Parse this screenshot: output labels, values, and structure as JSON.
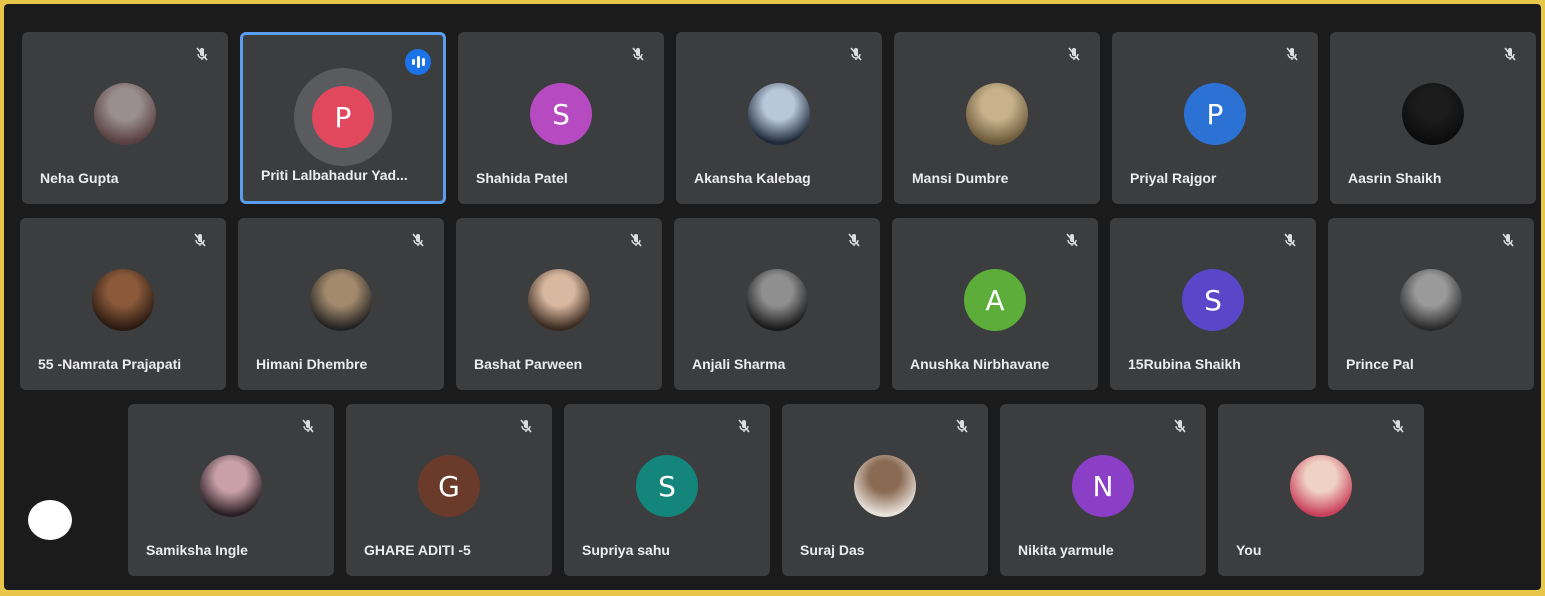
{
  "colors": {
    "tile_bg": "#3c3d3f",
    "active_speaker_border": "#5b9ded"
  },
  "participants": [
    {
      "name": "Neha Gupta",
      "type": "photo",
      "tint": [
        "#5a4040",
        "#9a8f8f"
      ],
      "muted": true
    },
    {
      "name": "Priti Lalbahadur Yad...",
      "type": "letter",
      "initial": "P",
      "color": "#e1485e",
      "speaking": true
    },
    {
      "name": "Shahida Patel",
      "type": "letter",
      "initial": "S",
      "color": "#b64bc1",
      "muted": true
    },
    {
      "name": "Akansha Kalebag",
      "type": "photo",
      "tint": [
        "#1e2a3a",
        "#b8c7d9"
      ],
      "muted": true
    },
    {
      "name": "Mansi Dumbre",
      "type": "photo",
      "tint": [
        "#6d5a3a",
        "#c7b28c"
      ],
      "muted": true
    },
    {
      "name": "Priyal Rajgor",
      "type": "letter",
      "initial": "P",
      "color": "#2b72d4",
      "muted": true
    },
    {
      "name": "Aasrin Shaikh",
      "type": "photo",
      "tint": [
        "#0c0c0c",
        "#1c1c1c"
      ],
      "muted": true
    },
    {
      "name": "55 -Namrata Prajapati",
      "type": "photo",
      "tint": [
        "#2a1a12",
        "#8a5a3a"
      ],
      "muted": true
    },
    {
      "name": "Himani Dhembre",
      "type": "photo",
      "tint": [
        "#222",
        "#a38a6d"
      ],
      "muted": true
    },
    {
      "name": "Bashat Parween",
      "type": "photo",
      "tint": [
        "#3a2a20",
        "#d9b8a0"
      ],
      "muted": true
    },
    {
      "name": "Anjali Sharma",
      "type": "photo",
      "tint": [
        "#1a1a1a",
        "#8f8f8f"
      ],
      "muted": true
    },
    {
      "name": "Anushka Nirbhavane",
      "type": "letter",
      "initial": "A",
      "color": "#5dad3a",
      "muted": true
    },
    {
      "name": "15Rubina Shaikh",
      "type": "letter",
      "initial": "S",
      "color": "#5b45c9",
      "muted": true
    },
    {
      "name": "Prince Pal",
      "type": "photo",
      "tint": [
        "#2a2a2a",
        "#9a9a9a"
      ],
      "muted": true
    },
    {
      "name": "Samiksha Ingle",
      "type": "photo",
      "tint": [
        "#2a1f24",
        "#c9a0a8"
      ],
      "muted": true
    },
    {
      "name": "GHARE ADITI -5",
      "type": "letter",
      "initial": "G",
      "color": "#6a3a2a",
      "muted": true
    },
    {
      "name": "Supriya sahu",
      "type": "letter",
      "initial": "S",
      "color": "#14857b",
      "muted": true
    },
    {
      "name": "Suraj Das",
      "type": "photo",
      "tint": [
        "#e9e3dc",
        "#8a6a52"
      ],
      "muted": true
    },
    {
      "name": "Nikita yarmule",
      "type": "letter",
      "initial": "N",
      "color": "#8b3fc7",
      "muted": true
    },
    {
      "name": "You",
      "type": "photo",
      "tint": [
        "#c9405a",
        "#f0d2c4"
      ],
      "muted": true
    }
  ]
}
